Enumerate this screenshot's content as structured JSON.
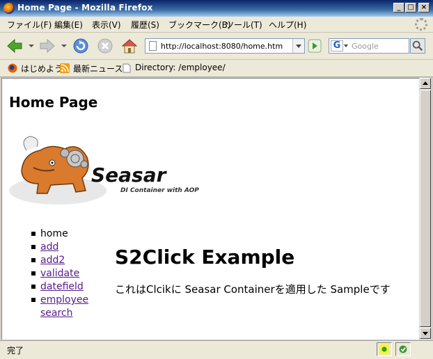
{
  "window": {
    "title": "Home Page - Mozilla Firefox"
  },
  "menu": [
    "ファイル(F)",
    "編集(E)",
    "表示(V)",
    "履歴(S)",
    "ブックマーク(B)",
    "ツール(T)",
    "ヘルプ(H)"
  ],
  "navbar": {
    "url": "http://localhost:8080/home.htm",
    "search_placeholder": "Google",
    "search_engine_letter": "G"
  },
  "bookmarks": [
    "はじめよう",
    "最新ニュース",
    "Directory: /employee/"
  ],
  "page": {
    "heading": "Home Page",
    "nav": [
      "home",
      "add",
      "add2",
      "validate",
      "datefield",
      "employee search"
    ],
    "example_title": "S2Click Example",
    "example_desc": "これはClcikに Seasar Containerを適用した Sampleです",
    "logo": {
      "text": "Seasar",
      "subtext": "DI Container with AOP"
    }
  },
  "status": {
    "text": "完了"
  },
  "colors": {
    "visited_link": "#551a8b",
    "titlebar_start": "#0a246a",
    "titlebar_end": "#a6caf0"
  }
}
